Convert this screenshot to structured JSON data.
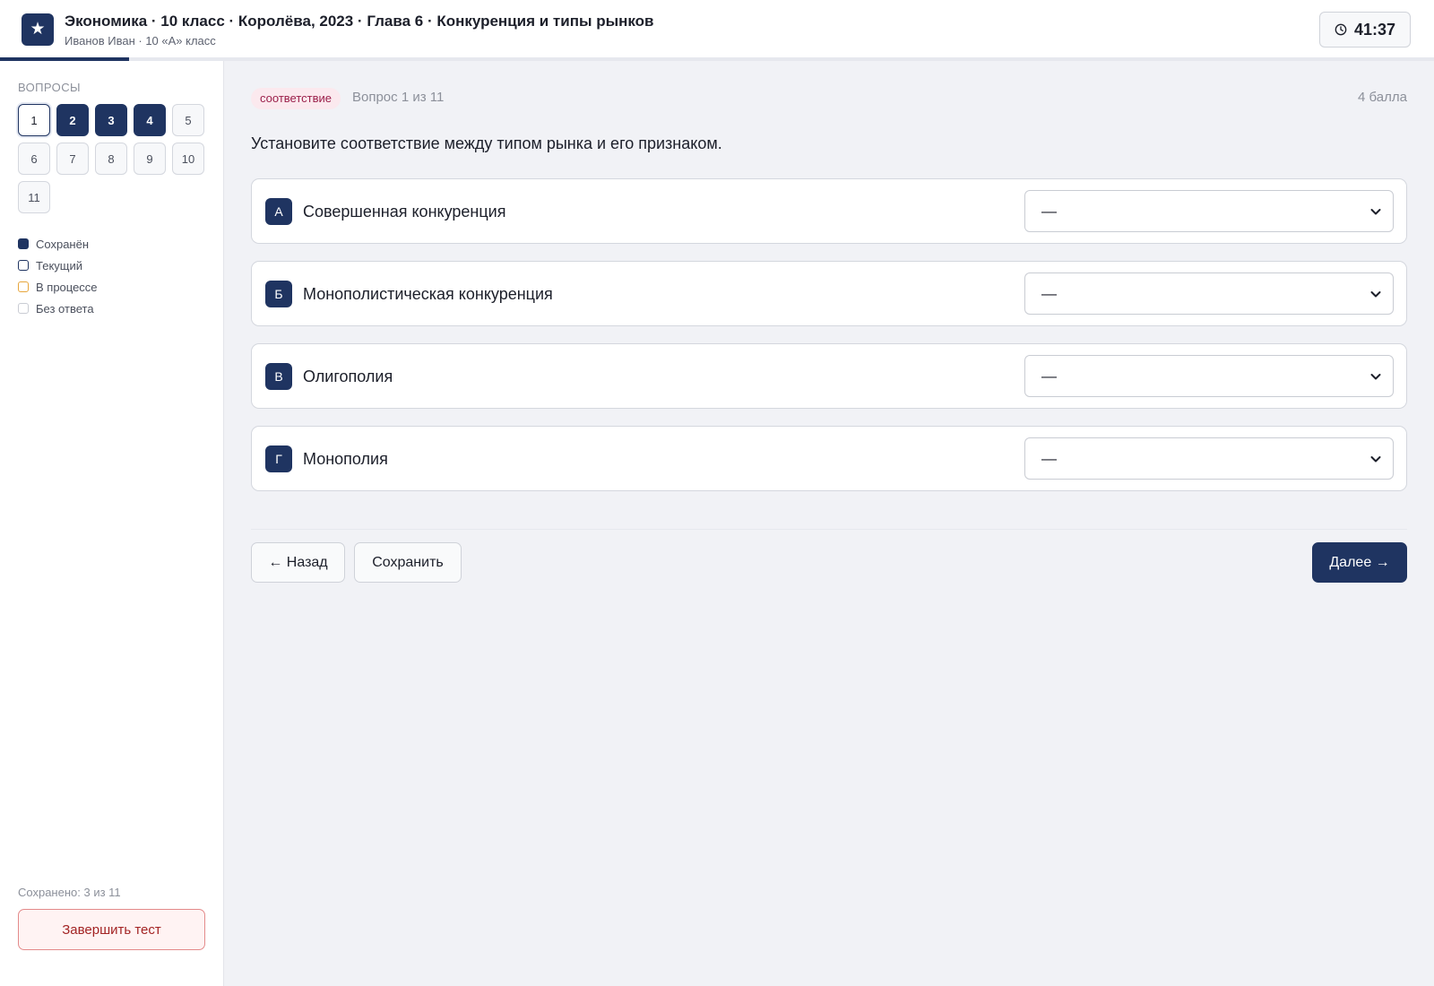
{
  "header": {
    "title": "Экономика · 10 класс · Королёва, 2023 · Глава 6 · Конкуренция и типы рынков",
    "subtitle": "Иванов Иван · 10 «А» класс",
    "logo_icon": "star-icon",
    "logo_glyph": "★",
    "timer": "41:37",
    "timer_icon": "clock-icon",
    "progress_fraction": 0.09
  },
  "sidebar": {
    "heading": "Вопросы",
    "questions": [
      {
        "label": "1",
        "state": "current"
      },
      {
        "label": "2",
        "state": "saved"
      },
      {
        "label": "3",
        "state": "saved"
      },
      {
        "label": "4",
        "state": "saved"
      },
      {
        "label": "5",
        "state": "none"
      },
      {
        "label": "6",
        "state": "none"
      },
      {
        "label": "7",
        "state": "none"
      },
      {
        "label": "8",
        "state": "none"
      },
      {
        "label": "9",
        "state": "none"
      },
      {
        "label": "10",
        "state": "none"
      },
      {
        "label": "11",
        "state": "none"
      }
    ],
    "legend": [
      {
        "label": "Сохранён",
        "state": "saved"
      },
      {
        "label": "Текущий",
        "state": "current"
      },
      {
        "label": "В процессе",
        "state": "progress"
      },
      {
        "label": "Без ответа",
        "state": "none"
      }
    ],
    "saved_count": "Сохранено: 3 из 11",
    "finish_label": "Завершить тест"
  },
  "main": {
    "tag": "соответствие",
    "question_number": "Вопрос 1 из 11",
    "points": "4 балла",
    "question_text": "Установите соответствие между типом рынка и его признаком.",
    "rows": [
      {
        "letter": "А",
        "label": "Совершенная конкуренция",
        "selected": "—"
      },
      {
        "letter": "Б",
        "label": "Монополистическая конкуренция",
        "selected": "—"
      },
      {
        "letter": "В",
        "label": "Олигополия",
        "selected": "—"
      },
      {
        "letter": "Г",
        "label": "Монополия",
        "selected": "—"
      }
    ],
    "back_label": "← Назад",
    "save_label": "Сохранить",
    "next_label": "Далее →"
  },
  "colors": {
    "accent": "#1f3461",
    "tag_text": "#9b1f4a",
    "tag_bg": "#fbe9ee",
    "danger": "#a32424",
    "in_progress": "#e7a63c"
  }
}
